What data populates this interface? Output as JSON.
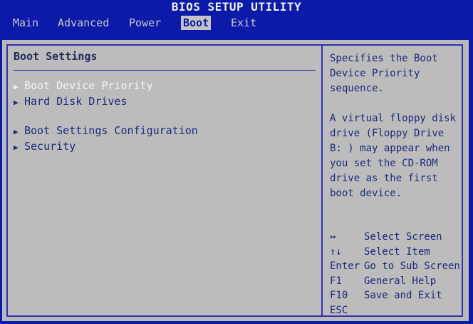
{
  "window_title": "BIOS SETUP UTILITY",
  "tabs": [
    {
      "label": "Main",
      "active": false
    },
    {
      "label": "Advanced",
      "active": false
    },
    {
      "label": "Power",
      "active": false
    },
    {
      "label": "Boot",
      "active": true
    },
    {
      "label": "Exit",
      "active": false
    }
  ],
  "section_title": "Boot Settings",
  "menu_items": [
    {
      "label": "Boot Device Priority",
      "selected": true
    },
    {
      "label": "Hard Disk Drives",
      "selected": false
    },
    {
      "label": "Boot Settings Configuration",
      "selected": false
    },
    {
      "label": "Security",
      "selected": false
    }
  ],
  "help": {
    "paragraphs": [
      "Specifies the Boot Device Priority sequence.",
      "A virtual floppy disk drive (Floppy Drive B: ) may appear when you set the CD-ROM drive as the first boot device."
    ]
  },
  "keys": [
    {
      "key": "↔",
      "desc": "Select Screen"
    },
    {
      "key": "↑↓",
      "desc": "Select Item"
    },
    {
      "key": "Enter",
      "desc": "Go to Sub Screen"
    },
    {
      "key": "F1",
      "desc": "General Help"
    },
    {
      "key": "F10",
      "desc": "Save and Exit"
    },
    {
      "key": "ESC",
      "desc": ""
    }
  ],
  "colors": {
    "bios_blue": "#0b1aa8",
    "panel_gray": "#bcbcbc",
    "text_blue": "#1b2a7a",
    "highlight_white": "#f4f4f4"
  },
  "icons": {
    "submenu_arrow": "arrow-right-icon"
  }
}
